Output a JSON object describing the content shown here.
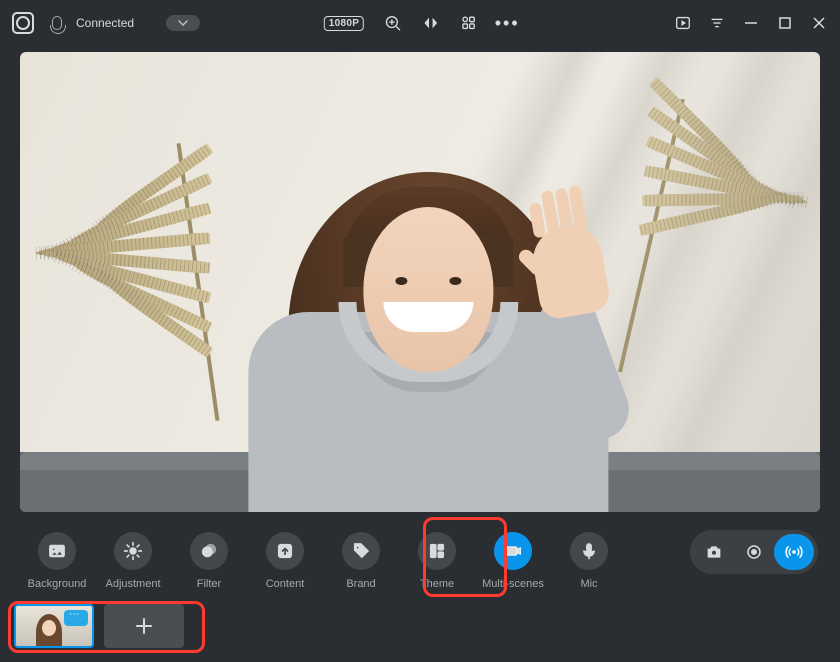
{
  "status": {
    "label": "Connected"
  },
  "titlebar": {
    "resolution": "1080P"
  },
  "toolbar": {
    "items": [
      {
        "id": "background",
        "label": "Background",
        "icon": "image"
      },
      {
        "id": "adjustment",
        "label": "Adjustment",
        "icon": "brightness"
      },
      {
        "id": "filter",
        "label": "Filter",
        "icon": "overlap"
      },
      {
        "id": "content",
        "label": "Content",
        "icon": "upload"
      },
      {
        "id": "brand",
        "label": "Brand",
        "icon": "tag"
      },
      {
        "id": "theme",
        "label": "Theme",
        "icon": "layout"
      },
      {
        "id": "multiscenes",
        "label": "Multi-scenes",
        "icon": "camera",
        "active": true
      },
      {
        "id": "mic",
        "label": "Mic",
        "icon": "mic"
      }
    ]
  },
  "colors": {
    "accent": "#0a95ec",
    "highlight": "#ff3b30"
  }
}
